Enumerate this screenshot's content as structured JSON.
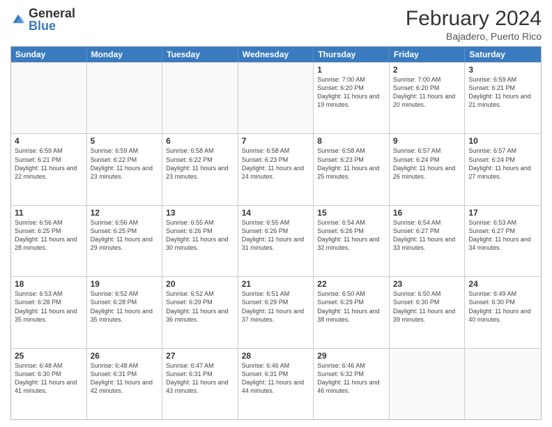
{
  "logo": {
    "general": "General",
    "blue": "Blue"
  },
  "title": {
    "month": "February 2024",
    "location": "Bajadero, Puerto Rico"
  },
  "header_days": [
    "Sunday",
    "Monday",
    "Tuesday",
    "Wednesday",
    "Thursday",
    "Friday",
    "Saturday"
  ],
  "weeks": [
    [
      {
        "day": "",
        "info": ""
      },
      {
        "day": "",
        "info": ""
      },
      {
        "day": "",
        "info": ""
      },
      {
        "day": "",
        "info": ""
      },
      {
        "day": "1",
        "info": "Sunrise: 7:00 AM\nSunset: 6:20 PM\nDaylight: 11 hours and 19 minutes."
      },
      {
        "day": "2",
        "info": "Sunrise: 7:00 AM\nSunset: 6:20 PM\nDaylight: 11 hours and 20 minutes."
      },
      {
        "day": "3",
        "info": "Sunrise: 6:59 AM\nSunset: 6:21 PM\nDaylight: 11 hours and 21 minutes."
      }
    ],
    [
      {
        "day": "4",
        "info": "Sunrise: 6:59 AM\nSunset: 6:21 PM\nDaylight: 11 hours and 22 minutes."
      },
      {
        "day": "5",
        "info": "Sunrise: 6:59 AM\nSunset: 6:22 PM\nDaylight: 11 hours and 23 minutes."
      },
      {
        "day": "6",
        "info": "Sunrise: 6:58 AM\nSunset: 6:22 PM\nDaylight: 11 hours and 23 minutes."
      },
      {
        "day": "7",
        "info": "Sunrise: 6:58 AM\nSunset: 6:23 PM\nDaylight: 11 hours and 24 minutes."
      },
      {
        "day": "8",
        "info": "Sunrise: 6:58 AM\nSunset: 6:23 PM\nDaylight: 11 hours and 25 minutes."
      },
      {
        "day": "9",
        "info": "Sunrise: 6:57 AM\nSunset: 6:24 PM\nDaylight: 11 hours and 26 minutes."
      },
      {
        "day": "10",
        "info": "Sunrise: 6:57 AM\nSunset: 6:24 PM\nDaylight: 11 hours and 27 minutes."
      }
    ],
    [
      {
        "day": "11",
        "info": "Sunrise: 6:56 AM\nSunset: 6:25 PM\nDaylight: 11 hours and 28 minutes."
      },
      {
        "day": "12",
        "info": "Sunrise: 6:56 AM\nSunset: 6:25 PM\nDaylight: 11 hours and 29 minutes."
      },
      {
        "day": "13",
        "info": "Sunrise: 6:55 AM\nSunset: 6:26 PM\nDaylight: 11 hours and 30 minutes."
      },
      {
        "day": "14",
        "info": "Sunrise: 6:55 AM\nSunset: 6:26 PM\nDaylight: 11 hours and 31 minutes."
      },
      {
        "day": "15",
        "info": "Sunrise: 6:54 AM\nSunset: 6:26 PM\nDaylight: 11 hours and 32 minutes."
      },
      {
        "day": "16",
        "info": "Sunrise: 6:54 AM\nSunset: 6:27 PM\nDaylight: 11 hours and 33 minutes."
      },
      {
        "day": "17",
        "info": "Sunrise: 6:53 AM\nSunset: 6:27 PM\nDaylight: 11 hours and 34 minutes."
      }
    ],
    [
      {
        "day": "18",
        "info": "Sunrise: 6:53 AM\nSunset: 6:28 PM\nDaylight: 11 hours and 35 minutes."
      },
      {
        "day": "19",
        "info": "Sunrise: 6:52 AM\nSunset: 6:28 PM\nDaylight: 11 hours and 35 minutes."
      },
      {
        "day": "20",
        "info": "Sunrise: 6:52 AM\nSunset: 6:29 PM\nDaylight: 11 hours and 36 minutes."
      },
      {
        "day": "21",
        "info": "Sunrise: 6:51 AM\nSunset: 6:29 PM\nDaylight: 11 hours and 37 minutes."
      },
      {
        "day": "22",
        "info": "Sunrise: 6:50 AM\nSunset: 6:29 PM\nDaylight: 11 hours and 38 minutes."
      },
      {
        "day": "23",
        "info": "Sunrise: 6:50 AM\nSunset: 6:30 PM\nDaylight: 11 hours and 39 minutes."
      },
      {
        "day": "24",
        "info": "Sunrise: 6:49 AM\nSunset: 6:30 PM\nDaylight: 11 hours and 40 minutes."
      }
    ],
    [
      {
        "day": "25",
        "info": "Sunrise: 6:48 AM\nSunset: 6:30 PM\nDaylight: 11 hours and 41 minutes."
      },
      {
        "day": "26",
        "info": "Sunrise: 6:48 AM\nSunset: 6:31 PM\nDaylight: 11 hours and 42 minutes."
      },
      {
        "day": "27",
        "info": "Sunrise: 6:47 AM\nSunset: 6:31 PM\nDaylight: 11 hours and 43 minutes."
      },
      {
        "day": "28",
        "info": "Sunrise: 6:46 AM\nSunset: 6:31 PM\nDaylight: 11 hours and 44 minutes."
      },
      {
        "day": "29",
        "info": "Sunrise: 6:46 AM\nSunset: 6:32 PM\nDaylight: 11 hours and 46 minutes."
      },
      {
        "day": "",
        "info": ""
      },
      {
        "day": "",
        "info": ""
      }
    ]
  ]
}
